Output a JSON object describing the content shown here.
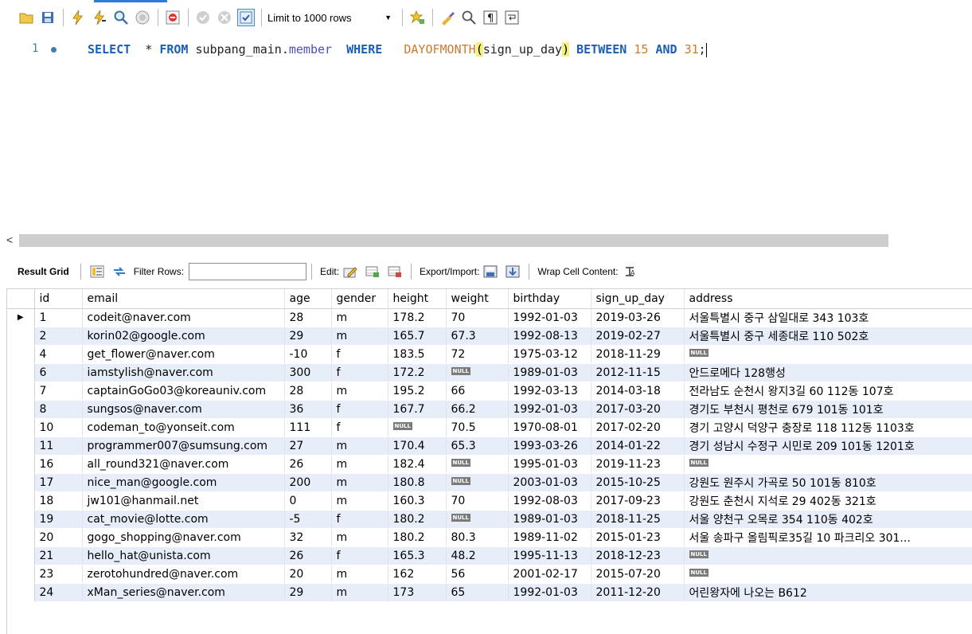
{
  "toolbar": {
    "limit_label": "Limit to 1000 rows"
  },
  "editor": {
    "line_number": "1",
    "tokens": {
      "select": "SELECT",
      "star": "*",
      "from": "FROM",
      "schema": "subpang_main.",
      "table": "member",
      "where": "WHERE",
      "func": "DAYOFMONTH",
      "paren_open": "(",
      "arg": "sign_up_day",
      "paren_close": ")",
      "between": "BETWEEN",
      "low": "15",
      "and": "AND",
      "high": "31",
      "semi": ";"
    }
  },
  "result_toolbar": {
    "result_grid": "Result Grid",
    "filter_rows": "Filter Rows:",
    "edit": "Edit:",
    "export_import": "Export/Import:",
    "wrap_cell": "Wrap Cell Content:"
  },
  "grid": {
    "null_text": "NULL",
    "columns": [
      "id",
      "email",
      "age",
      "gender",
      "height",
      "weight",
      "birthday",
      "sign_up_day",
      "address"
    ],
    "rows": [
      {
        "id": "1",
        "email": "codeit@naver.com",
        "age": "28",
        "gender": "m",
        "height": "178.2",
        "weight": "70",
        "birthday": "1992-01-03",
        "sign_up_day": "2019-03-26",
        "address": "서울특별시 중구 삼일대로 343 103호"
      },
      {
        "id": "2",
        "email": "korin02@google.com",
        "age": "29",
        "gender": "m",
        "height": "165.7",
        "weight": "67.3",
        "birthday": "1992-08-13",
        "sign_up_day": "2019-02-27",
        "address": "서울특별시 중구 세종대로 110 502호"
      },
      {
        "id": "4",
        "email": "get_flower@naver.com",
        "age": "-10",
        "gender": "f",
        "height": "183.5",
        "weight": "72",
        "birthday": "1975-03-12",
        "sign_up_day": "2018-11-29",
        "address": null
      },
      {
        "id": "6",
        "email": "iamstylish@naver.com",
        "age": "300",
        "gender": "f",
        "height": "172.2",
        "weight": null,
        "birthday": "1989-01-03",
        "sign_up_day": "2012-11-15",
        "address": "안드로메다 128행성"
      },
      {
        "id": "7",
        "email": "captainGoGo03@koreauniv.com",
        "age": "28",
        "gender": "m",
        "height": "195.2",
        "weight": "66",
        "birthday": "1992-03-13",
        "sign_up_day": "2014-03-18",
        "address": "전라남도 순천시 왕지3길 60 112동 107호"
      },
      {
        "id": "8",
        "email": "sungsos@naver.com",
        "age": "36",
        "gender": "f",
        "height": "167.7",
        "weight": "66.2",
        "birthday": "1992-01-03",
        "sign_up_day": "2017-03-20",
        "address": "경기도 부천시 평천로 679 101동 101호"
      },
      {
        "id": "10",
        "email": "codeman_to@yonseit.com",
        "age": "111",
        "gender": "f",
        "height": null,
        "weight": "70.5",
        "birthday": "1970-08-01",
        "sign_up_day": "2017-02-20",
        "address": "경기 고양시 덕양구 충장로 118 112동 1103호"
      },
      {
        "id": "11",
        "email": "programmer007@sumsung.com",
        "age": "27",
        "gender": "m",
        "height": "170.4",
        "weight": "65.3",
        "birthday": "1993-03-26",
        "sign_up_day": "2014-01-22",
        "address": "경기 성남시 수정구 시민로 209 101동 1201호"
      },
      {
        "id": "16",
        "email": "all_round321@naver.com",
        "age": "26",
        "gender": "m",
        "height": "182.4",
        "weight": null,
        "birthday": "1995-01-03",
        "sign_up_day": "2019-11-23",
        "address": null
      },
      {
        "id": "17",
        "email": "nice_man@google.com",
        "age": "200",
        "gender": "m",
        "height": "180.8",
        "weight": null,
        "birthday": "2003-01-03",
        "sign_up_day": "2015-10-25",
        "address": "강원도 원주시 가곡로 50 101동 810호"
      },
      {
        "id": "18",
        "email": "jw101@hanmail.net",
        "age": "0",
        "gender": "m",
        "height": "160.3",
        "weight": "70",
        "birthday": "1992-08-03",
        "sign_up_day": "2017-09-23",
        "address": "강원도 춘천시 지석로 29 402동 321호"
      },
      {
        "id": "19",
        "email": "cat_movie@lotte.com",
        "age": "-5",
        "gender": "f",
        "height": "180.2",
        "weight": null,
        "birthday": "1989-01-03",
        "sign_up_day": "2018-11-25",
        "address": "서울 양천구 오목로 354 110동 402호"
      },
      {
        "id": "20",
        "email": "gogo_shopping@naver.com",
        "age": "32",
        "gender": "m",
        "height": "180.2",
        "weight": "80.3",
        "birthday": "1989-11-02",
        "sign_up_day": "2015-01-23",
        "address": "서울 송파구 올림픽로35길 10 파크리오 301..."
      },
      {
        "id": "21",
        "email": "hello_hat@unista.com",
        "age": "26",
        "gender": "f",
        "height": "165.3",
        "weight": "48.2",
        "birthday": "1995-11-13",
        "sign_up_day": "2018-12-23",
        "address": null
      },
      {
        "id": "23",
        "email": "zerotohundred@naver.com",
        "age": "20",
        "gender": "m",
        "height": "162",
        "weight": "56",
        "birthday": "2001-02-17",
        "sign_up_day": "2015-07-20",
        "address": null
      },
      {
        "id": "24",
        "email": "xMan_series@naver.com",
        "age": "29",
        "gender": "m",
        "height": "173",
        "weight": "65",
        "birthday": "1992-01-03",
        "sign_up_day": "2011-12-20",
        "address": "어린왕자에 나오는 B612"
      }
    ]
  }
}
